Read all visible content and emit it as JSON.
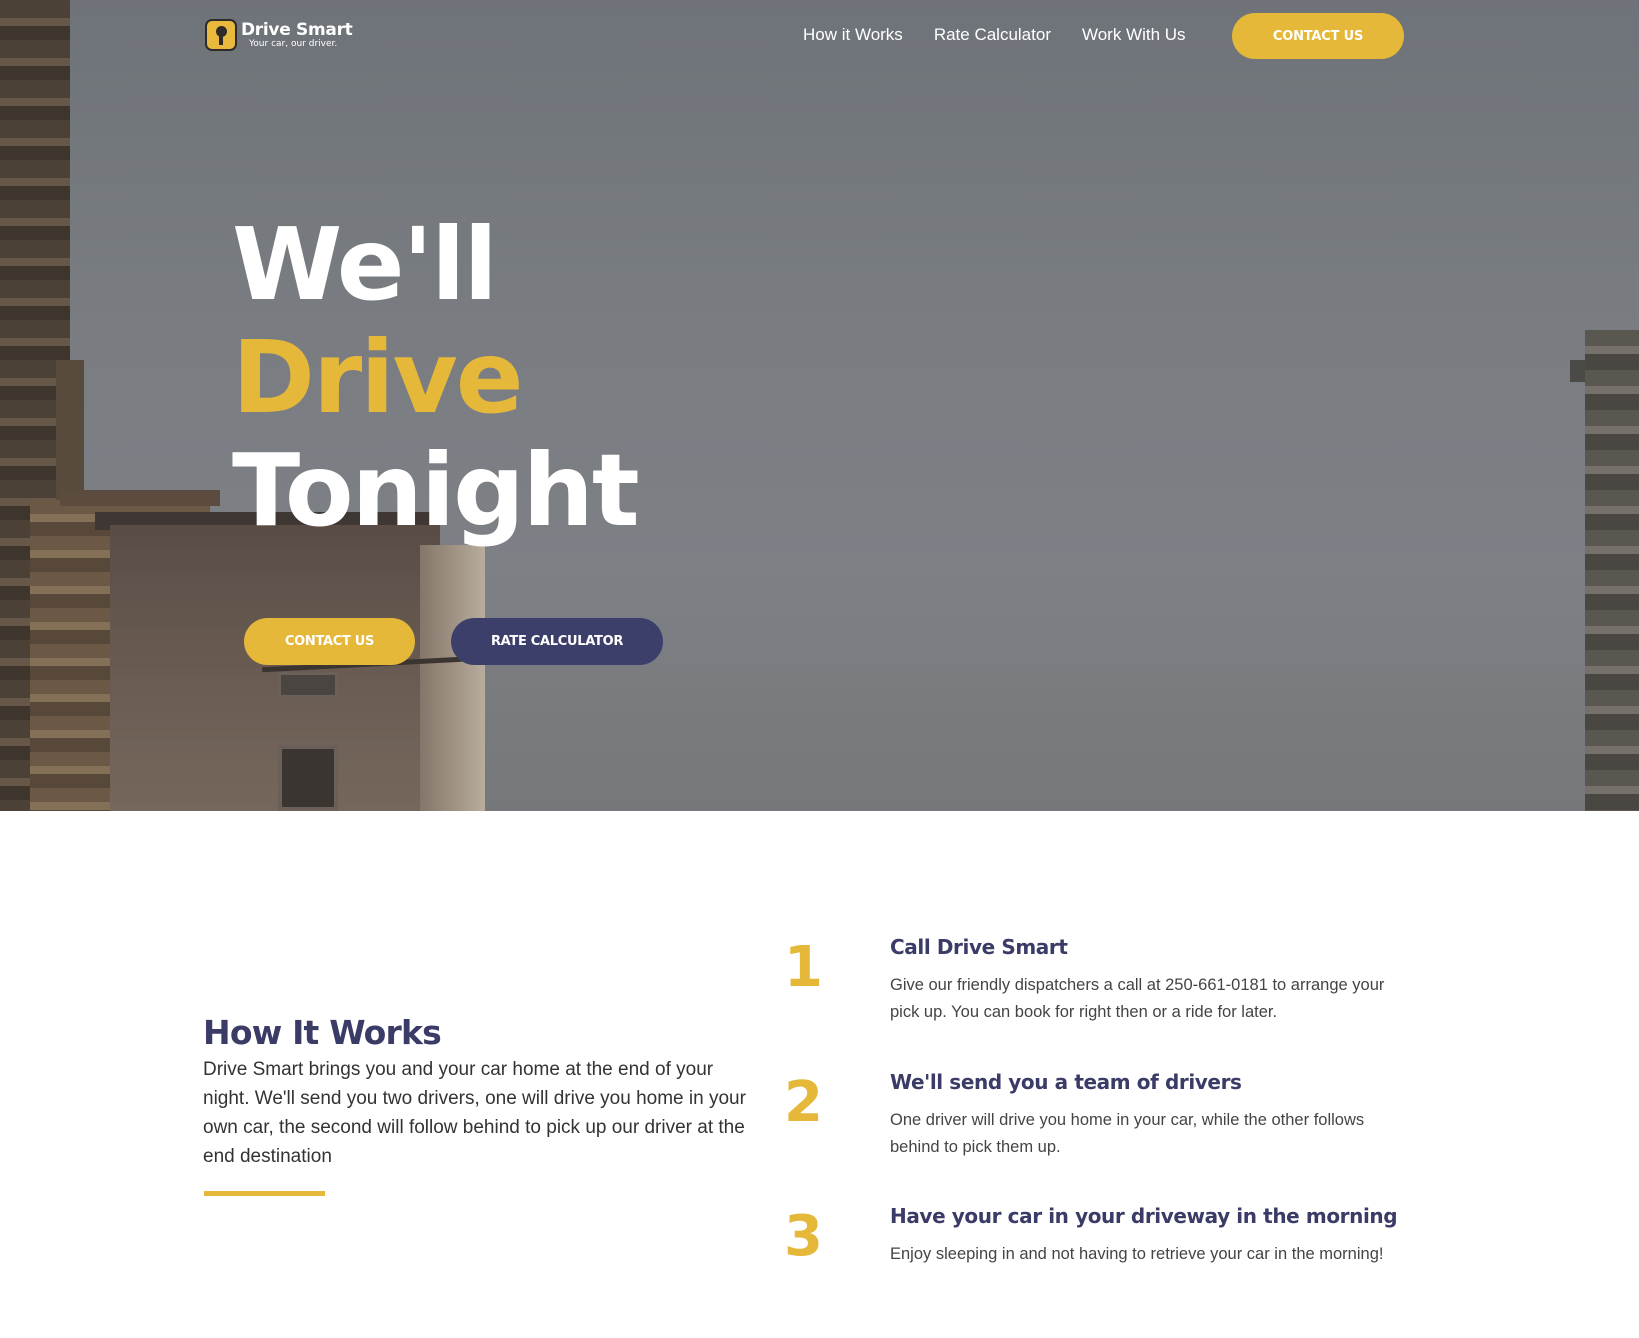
{
  "brand": {
    "name": "Drive Smart",
    "tagline": "Your car, our driver.",
    "accent_color": "#e5b83a",
    "navy_color": "#3d3f6b",
    "logo_icon": "lightbulb-icon"
  },
  "nav": {
    "links": [
      {
        "label": "How it Works"
      },
      {
        "label": "Rate Calculator"
      },
      {
        "label": "Work With Us"
      }
    ],
    "cta_label": "CONTACT US"
  },
  "hero": {
    "line1": "We'll",
    "line2": "Drive",
    "line3": "Tonight",
    "contact_label": "CONTACT US",
    "rate_label": "RATE CALCULATOR"
  },
  "how_it_works": {
    "title": "How It Works",
    "description": "Drive Smart brings you and your car home at the end of your night.  We'll send you two drivers, one will drive you home in your own car, the second will follow behind to pick up our driver at the end destination",
    "steps": [
      {
        "number": "1",
        "title": "Call Drive Smart",
        "description": "Give our friendly dispatchers a call at 250-661-0181 to arrange your pick up. You can book for right then or a ride for later."
      },
      {
        "number": "2",
        "title": "We'll send you a team of drivers",
        "description": "One driver will drive you home in your car, while the other follows behind to pick them up."
      },
      {
        "number": "3",
        "title": "Have your car in your driveway in the morning",
        "description": "Enjoy sleeping in and not having to retrieve your car in the morning!"
      }
    ]
  }
}
